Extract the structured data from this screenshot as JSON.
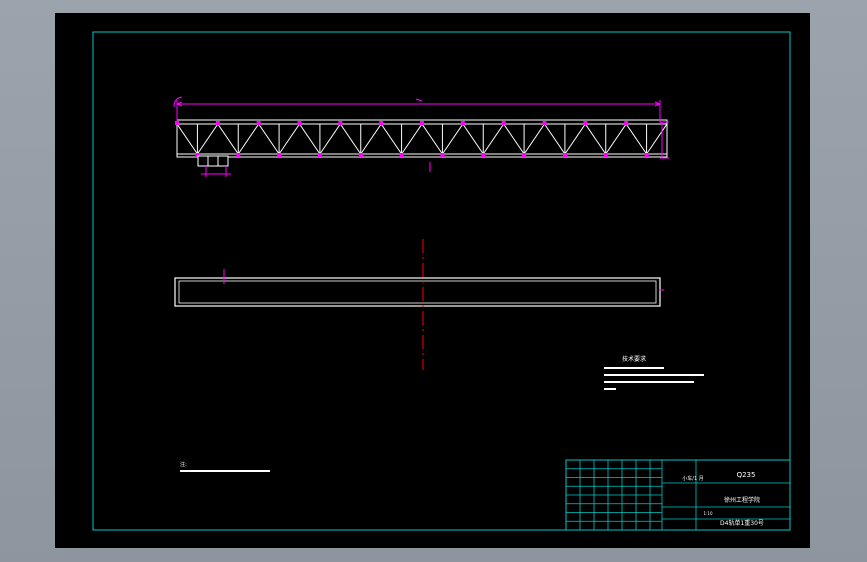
{
  "colors": {
    "background": "#000000",
    "frame": "#00c8c8",
    "truss": "#ffffff",
    "dimension": "#ff00ff",
    "centerline": "#ff0000",
    "text": "#ffffff"
  },
  "drawing": {
    "note_label": "注:",
    "tech_title": "技术要求",
    "material": "Q235",
    "school": "徐州工程学院",
    "drawing_no": "D4轨单1重30号",
    "scale": "1:10",
    "quantity": "小车/1 月"
  },
  "title_block": {
    "left_cells": [
      "标记",
      "处数",
      "分区",
      "更改文件号",
      "签名",
      "年月日",
      "设计",
      "标准化",
      "审核",
      "工艺",
      "批准"
    ],
    "mid_cells": [
      "阶段标记",
      "重量",
      "比例",
      "共张",
      "第张"
    ]
  }
}
